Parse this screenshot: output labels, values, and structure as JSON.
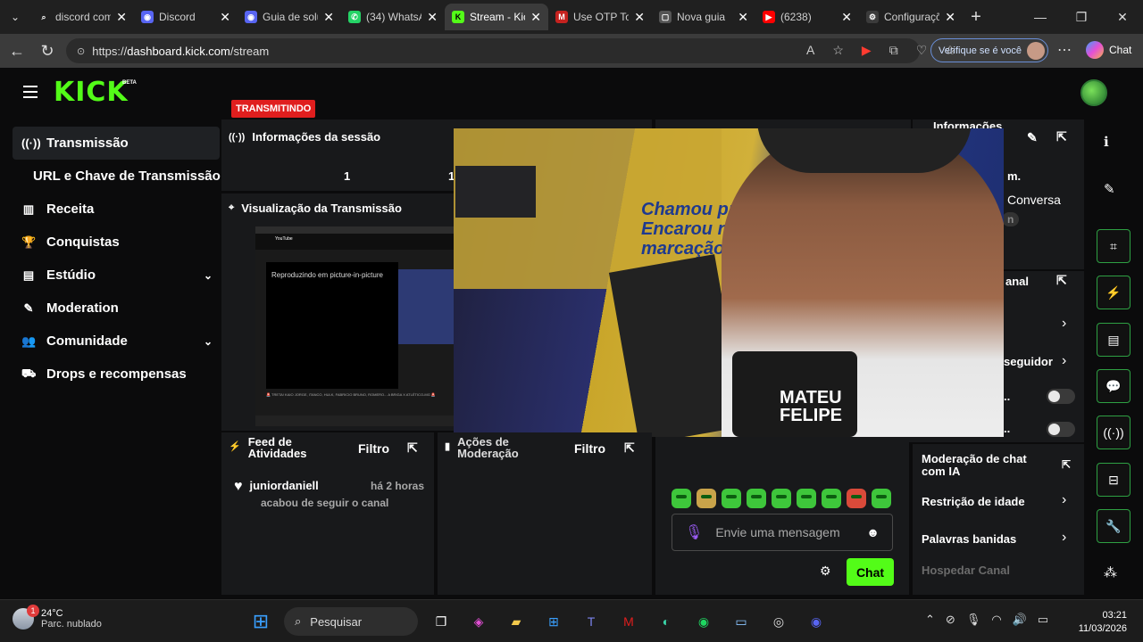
{
  "browser": {
    "tabs": [
      {
        "title": "discord com",
        "color": "#202020",
        "glyph": "⌕"
      },
      {
        "title": "Discord",
        "color": "#5865f2",
        "glyph": "◉"
      },
      {
        "title": "Guia de solu",
        "color": "#5865f2",
        "glyph": "◉"
      },
      {
        "title": "(34) WhatsA",
        "color": "#25d366",
        "glyph": "✆"
      },
      {
        "title": "Stream - Kic",
        "color": "#53fc18",
        "glyph": "K"
      },
      {
        "title": "Use OTP To",
        "color": "#c5221f",
        "glyph": "M"
      },
      {
        "title": "Nova guia",
        "color": "#555555",
        "glyph": "▢"
      },
      {
        "title": "(6238)",
        "color": "#ff0000",
        "glyph": "▶"
      },
      {
        "title": "Configuraçõ",
        "color": "#3b3b3b",
        "glyph": "⚙"
      }
    ],
    "active_tab": 4,
    "url_scheme": "https://",
    "url_host": "dashboard.kick.com",
    "url_path": "/stream",
    "verify_label": "Verifique se é você",
    "chat_label": "Chat"
  },
  "app": {
    "logo": "KICK",
    "beta": "BETA",
    "sidebar": [
      {
        "label": "Transmissão",
        "icon": "broadcast-icon",
        "glyph": "((·))",
        "active": true
      },
      {
        "label": "URL e Chave de Transmissão",
        "icon": "",
        "glyph": "",
        "sub": true
      },
      {
        "label": "Receita",
        "icon": "chart-icon",
        "glyph": "▥"
      },
      {
        "label": "Conquistas",
        "icon": "trophy-icon",
        "glyph": "🏆"
      },
      {
        "label": "Estúdio",
        "icon": "studio-icon",
        "glyph": "▤",
        "expand": true
      },
      {
        "label": "Moderation",
        "icon": "wrench-icon",
        "glyph": "✎"
      },
      {
        "label": "Comunidade",
        "icon": "people-icon",
        "glyph": "👥",
        "expand": true
      },
      {
        "label": "Drops e recompensas",
        "icon": "gift-icon",
        "glyph": "⛟"
      }
    ],
    "session": {
      "title": "Informações da sessão",
      "status": "TRANSMITINDO",
      "stat1": "1",
      "stat2": "1"
    },
    "preview": {
      "title": "Visualização da Transmissão",
      "pip_text": "Reproduzindo em picture-in-picture",
      "yt_label": "YouTube",
      "caption": "🚨 TRETA! KAIO JORGE, ITANCO, HULK, FABRICIO BRUNO, ROMERO... A BRIGA X ATLÉTICO-MG 🚨"
    },
    "video": {
      "wall_text": "Chamou pra\nEncarou na\nmarcação.",
      "mic_text": "MATEU\nFELIPE"
    },
    "info": {
      "title": "Informações",
      "partial_1": "m.",
      "partial_2": "Conversa",
      "partial_3": "n"
    },
    "channel_panel": {
      "title_partial": "anal",
      "followers_partial": "seguidor",
      "dots_1": "..",
      "dots_2": ".."
    },
    "activity": {
      "title": "Feed de Atividades",
      "filter": "Filtro",
      "user": "juniordaniell",
      "time": "há 2 horas",
      "desc": "acabou de seguir o canal"
    },
    "moderation_actions": {
      "title": "Ações de Moderação",
      "filter": "Filtro"
    },
    "chat": {
      "placeholder": "Envie uma mensagem",
      "button": "Chat"
    },
    "moderation_settings": {
      "ai": "Moderação de chat com IA",
      "age": "Restrição de idade",
      "banned": "Palavras banidas",
      "host": "Hospedar Canal"
    }
  },
  "taskbar": {
    "temp": "24°C",
    "weather": "Parc. nublado",
    "weather_badge": "1",
    "search": "Pesquisar",
    "time": "03:21",
    "date": "11/03/2026"
  }
}
